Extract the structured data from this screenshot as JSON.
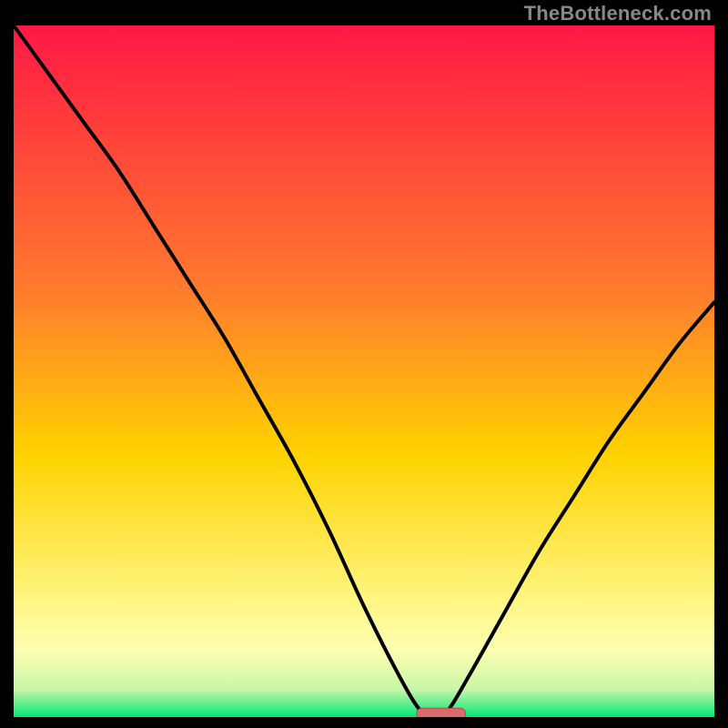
{
  "attribution": "TheBottleneck.com",
  "colors": {
    "bg_black": "#000000",
    "gradient_top": "#ff1844",
    "gradient_mid_upper": "#ff7a2e",
    "gradient_mid": "#ffd200",
    "gradient_low1": "#fff47a",
    "gradient_low2": "#fffeb1",
    "gradient_low3": "#c9f6a8",
    "gradient_bottom": "#00e676",
    "curve": "#000000",
    "marker_fill": "#d86b6b",
    "marker_stroke": "#b24e4e"
  },
  "chart_data": {
    "type": "line",
    "title": "",
    "xlabel": "",
    "ylabel": "",
    "xlim": [
      0,
      100
    ],
    "ylim": [
      0,
      100
    ],
    "x": [
      0,
      5,
      10,
      15,
      20,
      25,
      30,
      35,
      40,
      45,
      50,
      55,
      58,
      60,
      62,
      65,
      70,
      75,
      80,
      85,
      90,
      95,
      100
    ],
    "values": [
      100,
      93,
      86,
      79,
      71,
      63,
      55,
      46,
      37,
      27,
      16,
      6,
      1,
      0,
      1,
      6,
      15,
      24,
      32,
      40,
      47,
      54,
      60
    ],
    "optimum_x": 60,
    "optimum_y": 0,
    "marker": {
      "x_start": 57.5,
      "x_end": 64.5,
      "y": 0.5
    }
  }
}
